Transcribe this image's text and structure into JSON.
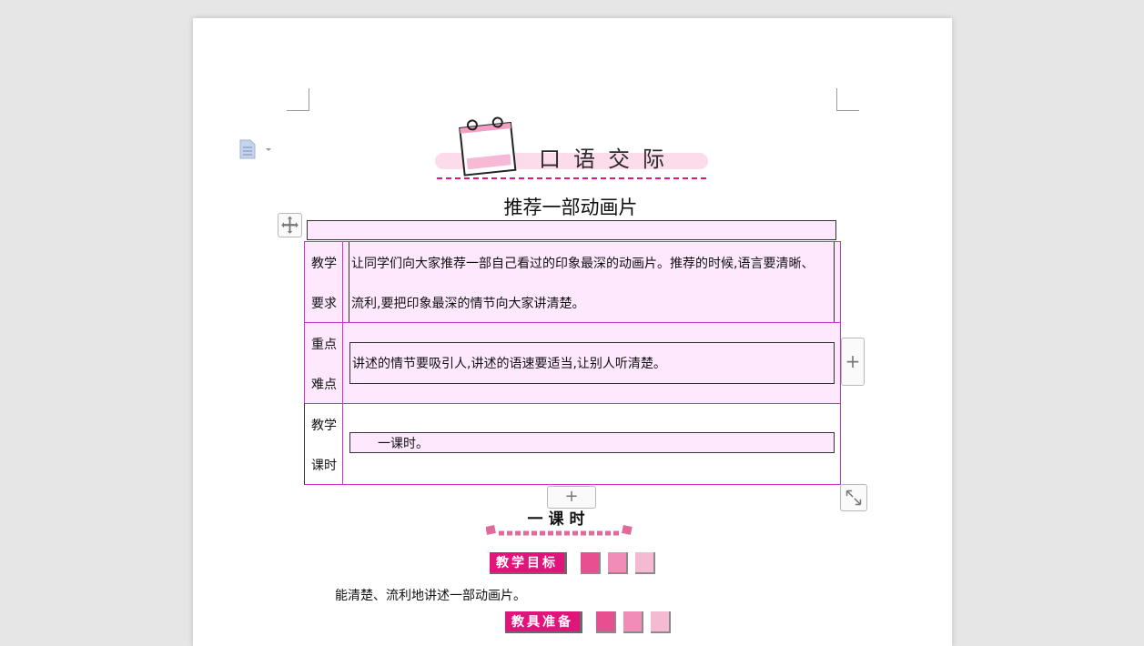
{
  "banner": {
    "title": "口语交际"
  },
  "document": {
    "title": "推荐一部动画片"
  },
  "table": {
    "rows": [
      {
        "label_line1": "教学",
        "label_line2": "要求",
        "text_line1": "让同学们向大家推荐一部自己看过的印象最深的动画片。推荐的时候,语言要清晰、",
        "text_line2": "流利,要把印象最深的情节向大家讲清楚。"
      },
      {
        "label_line1": "重点",
        "label_line2": "难点",
        "text_line1": "讲述的情节要吸引人,讲述的语速要适当,让别人听清楚。"
      },
      {
        "label_line1": "教学",
        "label_line2": "课时",
        "text_line1": "一课时。"
      }
    ]
  },
  "controls": {
    "add_column": "+",
    "add_row": "+"
  },
  "lesson": {
    "heading": "一课时"
  },
  "section_goal": {
    "label": "教学目标",
    "text": "能清楚、流利地讲述一部动画片。"
  },
  "section_prep": {
    "label": "教具准备"
  },
  "colors": {
    "accent_pink": "#e0157b",
    "table_border": "#cc33cc",
    "cell_fill": "#fde8fd"
  },
  "icons": [
    "document-icon",
    "move-handle-icon",
    "resize-icon",
    "notebook-icon"
  ]
}
